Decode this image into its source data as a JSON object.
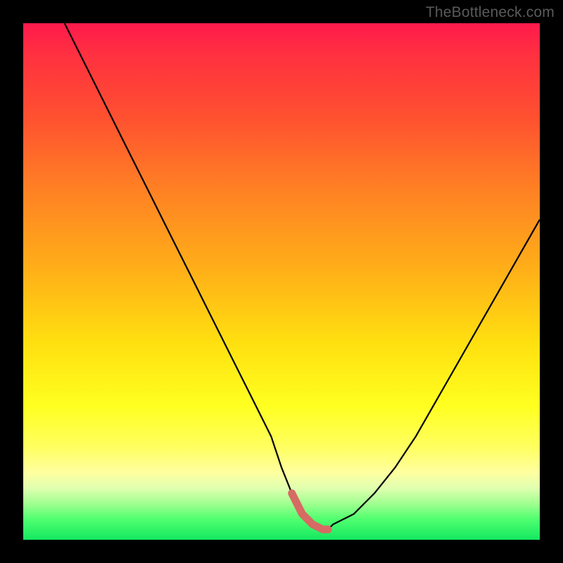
{
  "watermark": "TheBottleneck.com",
  "colors": {
    "frame": "#000000",
    "curve": "#000000",
    "marker": "#d66b63",
    "gradient_top": "#ff1a4d",
    "gradient_bottom": "#14e860"
  },
  "chart_data": {
    "type": "line",
    "title": "",
    "xlabel": "",
    "ylabel": "",
    "xlim": [
      0,
      100
    ],
    "ylim": [
      0,
      100
    ],
    "series": [
      {
        "name": "curve",
        "x": [
          8,
          12,
          16,
          20,
          24,
          28,
          32,
          36,
          40,
          44,
          48,
          50,
          52,
          54,
          56,
          58,
          59,
          60,
          64,
          68,
          72,
          76,
          80,
          84,
          88,
          92,
          96,
          100
        ],
        "values": [
          100,
          92,
          84,
          76,
          68,
          60,
          52,
          44,
          36,
          28,
          20,
          14,
          9,
          5,
          3,
          2,
          2,
          3,
          5,
          9,
          14,
          20,
          27,
          34,
          41,
          48,
          55,
          62
        ]
      }
    ],
    "marker_segment": {
      "x": [
        52,
        54,
        56,
        58,
        59
      ],
      "values": [
        9,
        5,
        3,
        2,
        2
      ]
    }
  }
}
